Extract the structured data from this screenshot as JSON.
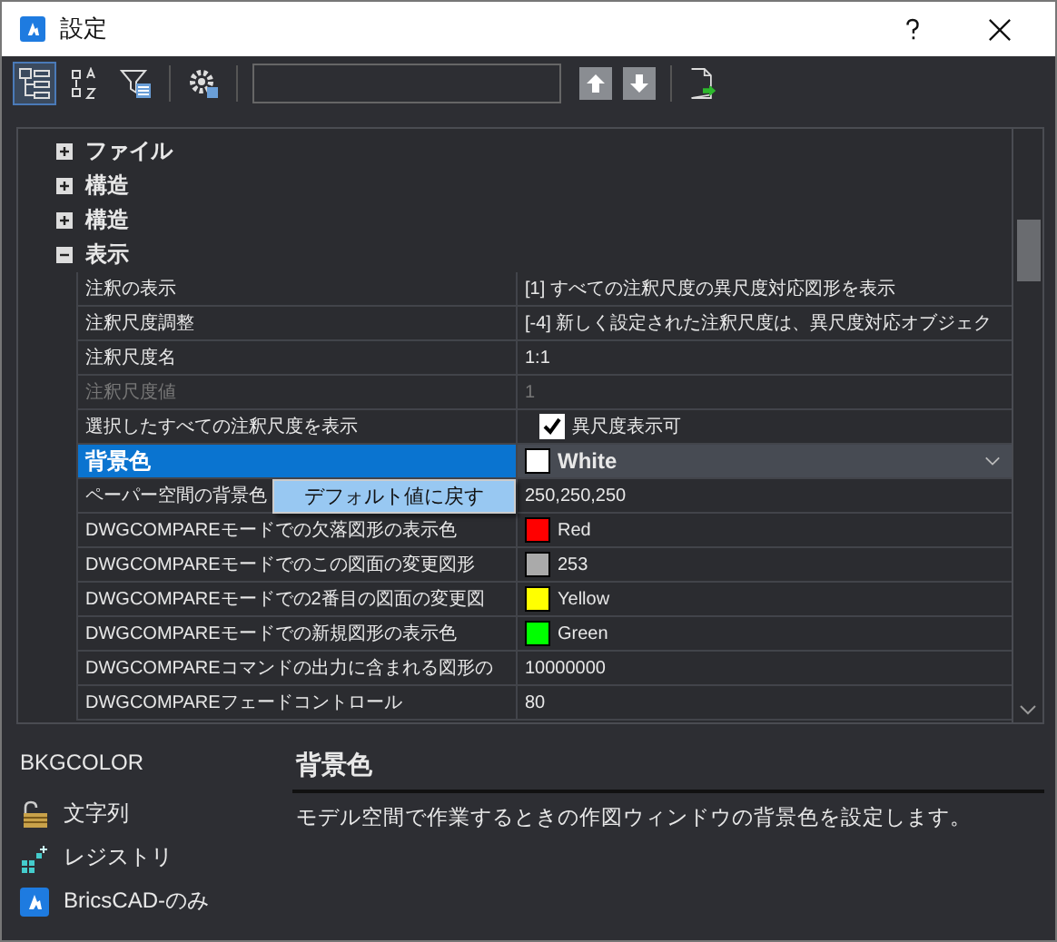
{
  "window": {
    "title": "設定"
  },
  "view_buttons": [
    {
      "kind": "categorized",
      "selected": true
    },
    {
      "kind": "alphabetical",
      "selected": false
    },
    {
      "kind": "filter",
      "selected": false
    }
  ],
  "tree": [
    {
      "label": "ファイル",
      "expanded": false
    },
    {
      "label": "構造",
      "expanded": false
    },
    {
      "label": "構造",
      "expanded": false
    },
    {
      "label": "表示",
      "expanded": true,
      "children": [
        {
          "name": "注釈の表示",
          "value": "[1] すべての注釈尺度の異尺度対応図形を表示",
          "kind": "text",
          "selected": false,
          "disabled": false
        },
        {
          "name": "注釈尺度調整",
          "value": "[-4] 新しく設定された注釈尺度は、異尺度対応オブジェク",
          "kind": "text",
          "selected": false,
          "disabled": false
        },
        {
          "name": "注釈尺度名",
          "value": "1:1",
          "kind": "text",
          "selected": false,
          "disabled": false
        },
        {
          "name": "注釈尺度値",
          "value": "1",
          "kind": "text",
          "selected": false,
          "disabled": true
        },
        {
          "name": "選択したすべての注釈尺度を表示",
          "value": "異尺度表示可",
          "kind": "checkbox",
          "checked": true,
          "selected": false,
          "disabled": false
        },
        {
          "name": "背景色",
          "value": "White",
          "kind": "dropdown",
          "color": "#ffffff",
          "selected": true,
          "disabled": false
        },
        {
          "name": "ペーパー空間の背景色",
          "value": "250,250,250",
          "kind": "text",
          "selected": false,
          "disabled": false
        },
        {
          "name": "DWGCOMPAREモードでの欠落図形の表示色",
          "value": "Red",
          "kind": "color",
          "color": "#ff0000",
          "selected": false,
          "disabled": false
        },
        {
          "name": "DWGCOMPAREモードでのこの図面の変更図形",
          "value": "253",
          "kind": "color",
          "color": "#aaaaaa",
          "selected": false,
          "disabled": false
        },
        {
          "name": "DWGCOMPAREモードでの2番目の図面の変更図",
          "value": "Yellow",
          "kind": "color",
          "color": "#ffff00",
          "selected": false,
          "disabled": false
        },
        {
          "name": "DWGCOMPAREモードでの新規図形の表示色",
          "value": "Green",
          "kind": "color",
          "color": "#00ff00",
          "selected": false,
          "disabled": false
        },
        {
          "name": "DWGCOMPAREコマンドの出力に含まれる図形の",
          "value": "10000000",
          "kind": "text",
          "selected": false,
          "disabled": false
        },
        {
          "name": "DWGCOMPAREフェードコントロール",
          "value": "80",
          "kind": "text",
          "selected": false,
          "disabled": false
        }
      ]
    }
  ],
  "context_menu": {
    "items": [
      {
        "label": "デフォルト値に戻す"
      }
    ]
  },
  "info": {
    "command": "BKGCOLOR",
    "tags": [
      {
        "kind": "string",
        "label": "文字列"
      },
      {
        "kind": "registry",
        "label": "レジストリ"
      },
      {
        "kind": "brics",
        "label": "BricsCAD-のみ"
      }
    ],
    "title": "背景色",
    "description": "モデル空間で作業するときの作図ウィンドウの背景色を設定します。"
  }
}
